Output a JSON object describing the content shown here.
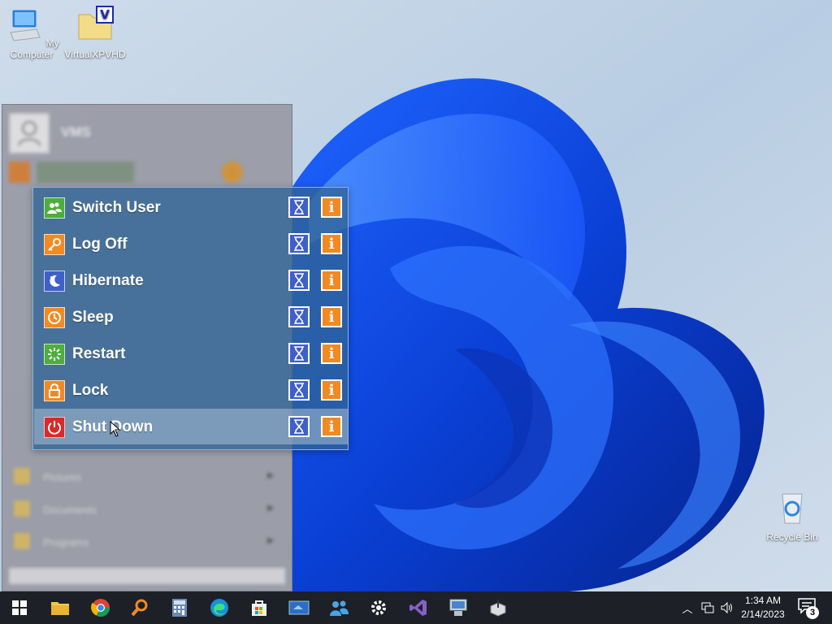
{
  "desktop": {
    "icons": [
      {
        "label": "My Computer",
        "icon": "computer-icon"
      },
      {
        "label": "VirtualXPVHD",
        "icon": "folder-vhd-icon"
      },
      {
        "label": "Recycle Bin",
        "icon": "recycle-bin-icon"
      }
    ]
  },
  "start_menu": {
    "user_name": "VMS",
    "items": [
      "Pictures",
      "Documents",
      "Programs"
    ]
  },
  "power_menu": {
    "items": [
      {
        "label": "Switch User",
        "icon": "switch-user-icon",
        "color": "#4caf3a"
      },
      {
        "label": "Log Off",
        "icon": "key-icon",
        "color": "#f28a22"
      },
      {
        "label": "Hibernate",
        "icon": "moon-icon",
        "color": "#3f5fc9"
      },
      {
        "label": "Sleep",
        "icon": "power-clock-icon",
        "color": "#f28a22"
      },
      {
        "label": "Restart",
        "icon": "restart-icon",
        "color": "#4caf3a"
      },
      {
        "label": "Lock",
        "icon": "lock-icon",
        "color": "#f28a22"
      },
      {
        "label": "Shut Down",
        "icon": "power-icon",
        "color": "#d92b2b"
      }
    ],
    "hovered_item": "Shut Down"
  },
  "taskbar": {
    "apps": [
      "start-icon",
      "file-explorer-icon",
      "chrome-icon",
      "search-magnifier-icon",
      "calculator-icon",
      "edge-icon",
      "store-icon",
      "film-icon",
      "people-icon",
      "settings-gear-icon",
      "visual-studio-icon",
      "remote-desktop-icon",
      "installer-icon"
    ],
    "clock": {
      "time": "1:34 AM",
      "date": "2/14/2023"
    },
    "notification_count": "3"
  }
}
